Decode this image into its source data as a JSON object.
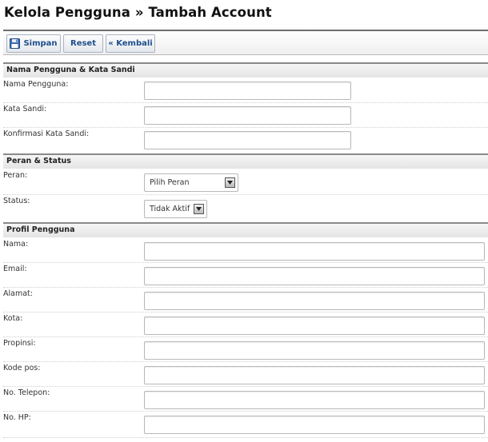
{
  "page": {
    "title": "Kelola Pengguna » Tambah Account"
  },
  "toolbar": {
    "save_label": "Simpan",
    "reset_label": "Reset",
    "back_label": "« Kembali",
    "save_icon": "floppy-disk-icon"
  },
  "sections": {
    "credentials": {
      "title": "Nama Pengguna & Kata Sandi",
      "username_label": "Nama Pengguna:",
      "password_label": "Kata Sandi:",
      "confirm_label": "Konfirmasi Kata Sandi:"
    },
    "role_status": {
      "title": "Peran & Status",
      "role_label": "Peran:",
      "role_value": "Pilih Peran",
      "status_label": "Status:",
      "status_value": "Tidak Aktif"
    },
    "profile": {
      "title": "Profil Pengguna",
      "name_label": "Nama:",
      "email_label": "Email:",
      "address_label": "Alamat:",
      "city_label": "Kota:",
      "province_label": "Propinsi:",
      "postal_label": "Kode pos:",
      "phone_label": "No. Telepon:",
      "mobile_label": "No. HP:"
    }
  },
  "colors": {
    "link_blue": "#1f4e8c",
    "section_bg": "#e4e4e4"
  }
}
